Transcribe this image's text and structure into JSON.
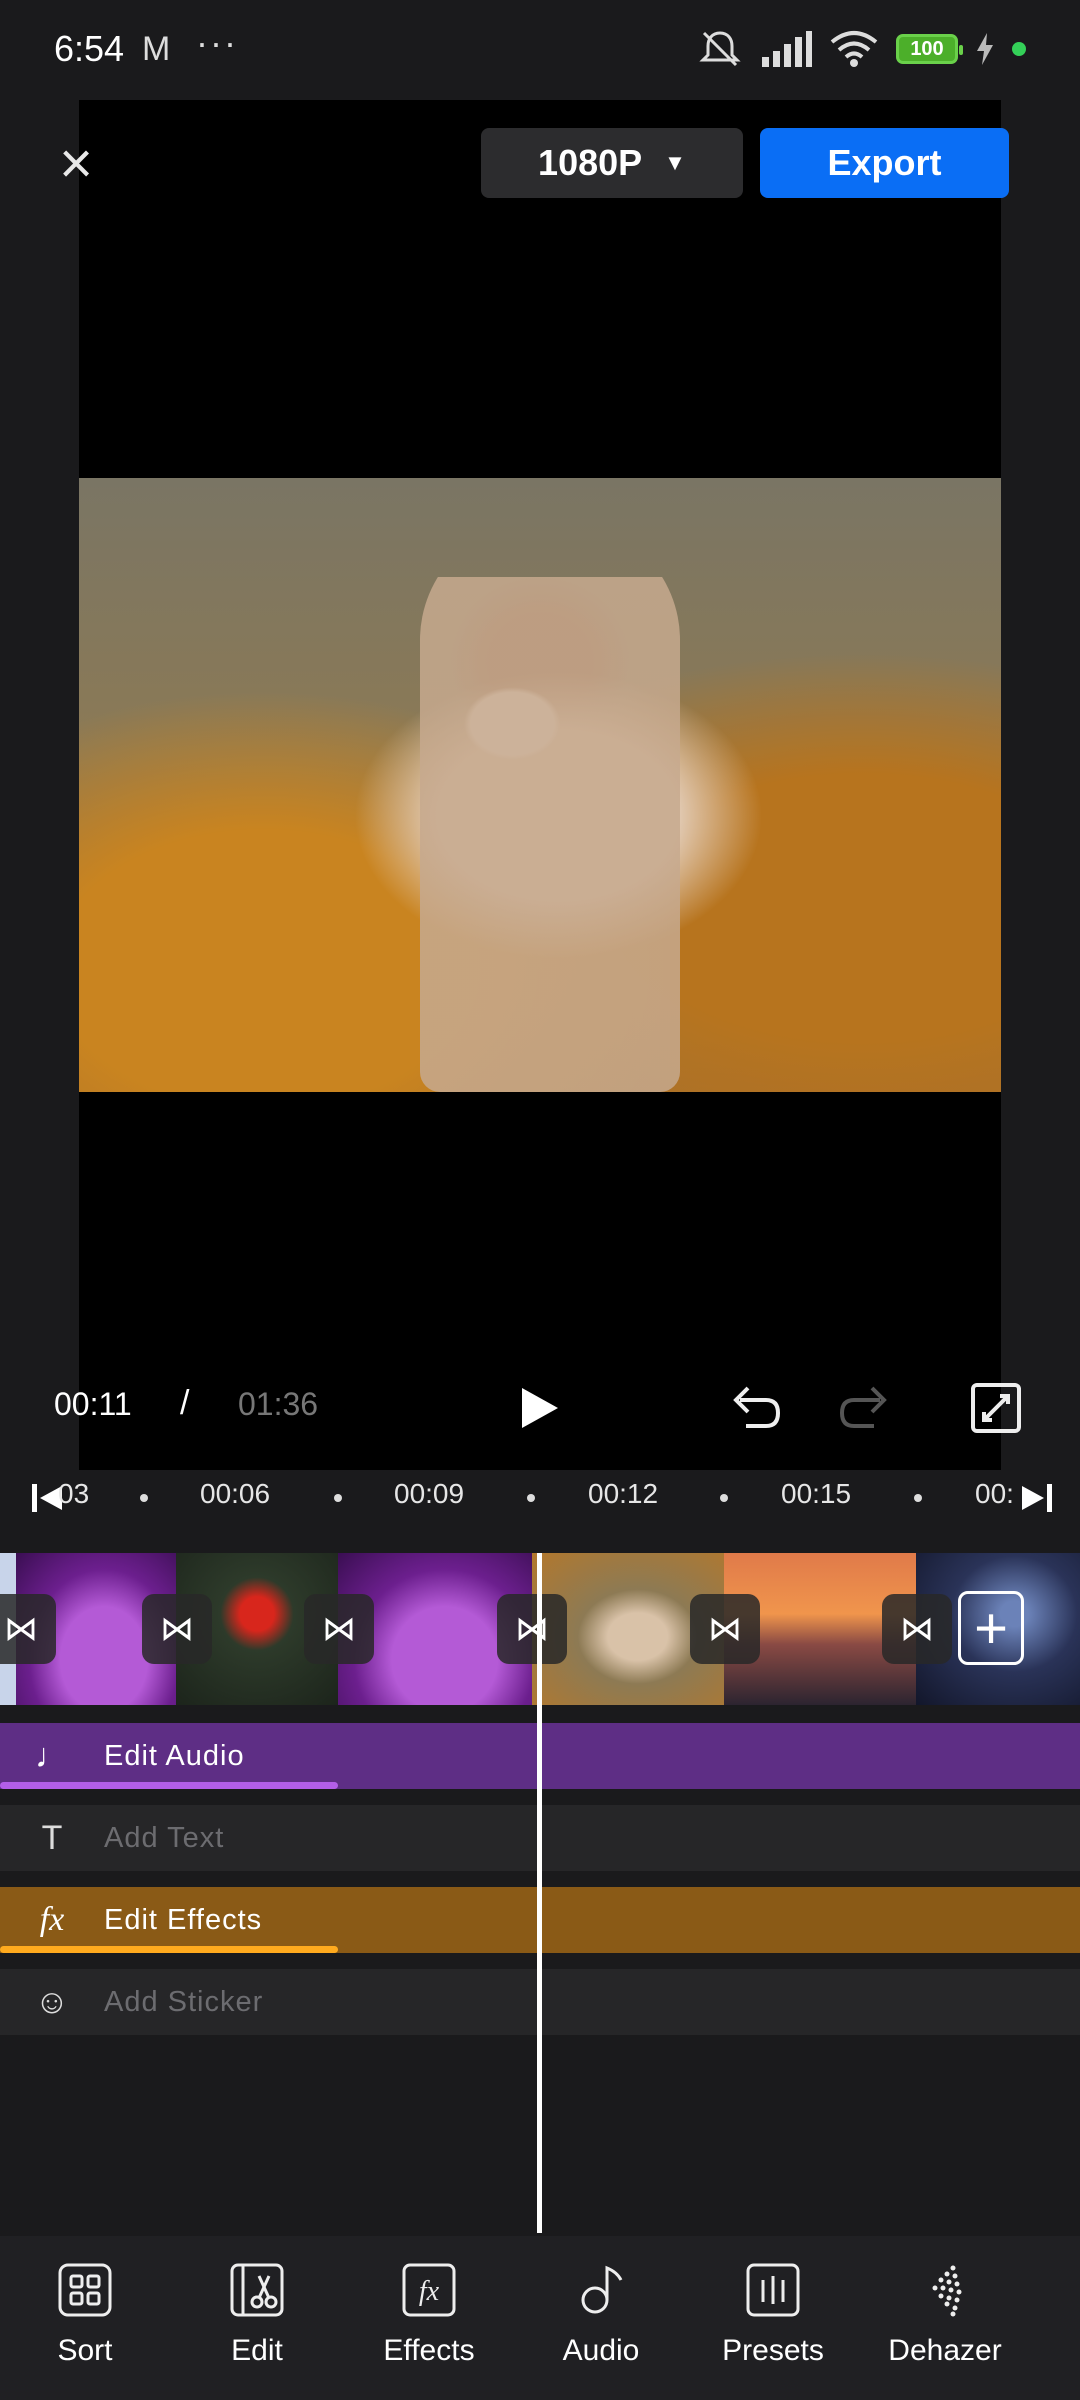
{
  "status_bar": {
    "time": "6:54",
    "mail_icon": "M",
    "more": "···",
    "battery": "100"
  },
  "top_bar": {
    "resolution": "1080P",
    "export_label": "Export"
  },
  "playback": {
    "current_time": "00:11",
    "separator": "/",
    "total_time": "01:36"
  },
  "ruler": {
    "ticks": [
      "03",
      "00:06",
      "00:09",
      "00:12",
      "00:15",
      "00:"
    ]
  },
  "tracks": {
    "audio": "Edit Audio",
    "text": "Add Text",
    "effects": "Edit Effects",
    "sticker": "Add Sticker"
  },
  "bottom_nav": {
    "items": [
      {
        "label": "Sort",
        "icon": "sort-grid-icon"
      },
      {
        "label": "Edit",
        "icon": "scissors-film-icon"
      },
      {
        "label": "Effects",
        "icon": "fx-icon"
      },
      {
        "label": "Audio",
        "icon": "music-note-icon"
      },
      {
        "label": "Presets",
        "icon": "presets-bars-icon"
      },
      {
        "label": "Dehazer",
        "icon": "dehazer-dots-icon"
      }
    ]
  },
  "colors": {
    "accent": "#0a6ef5",
    "audio_track": "#5e2e85",
    "effects_track": "#8a5a16"
  }
}
